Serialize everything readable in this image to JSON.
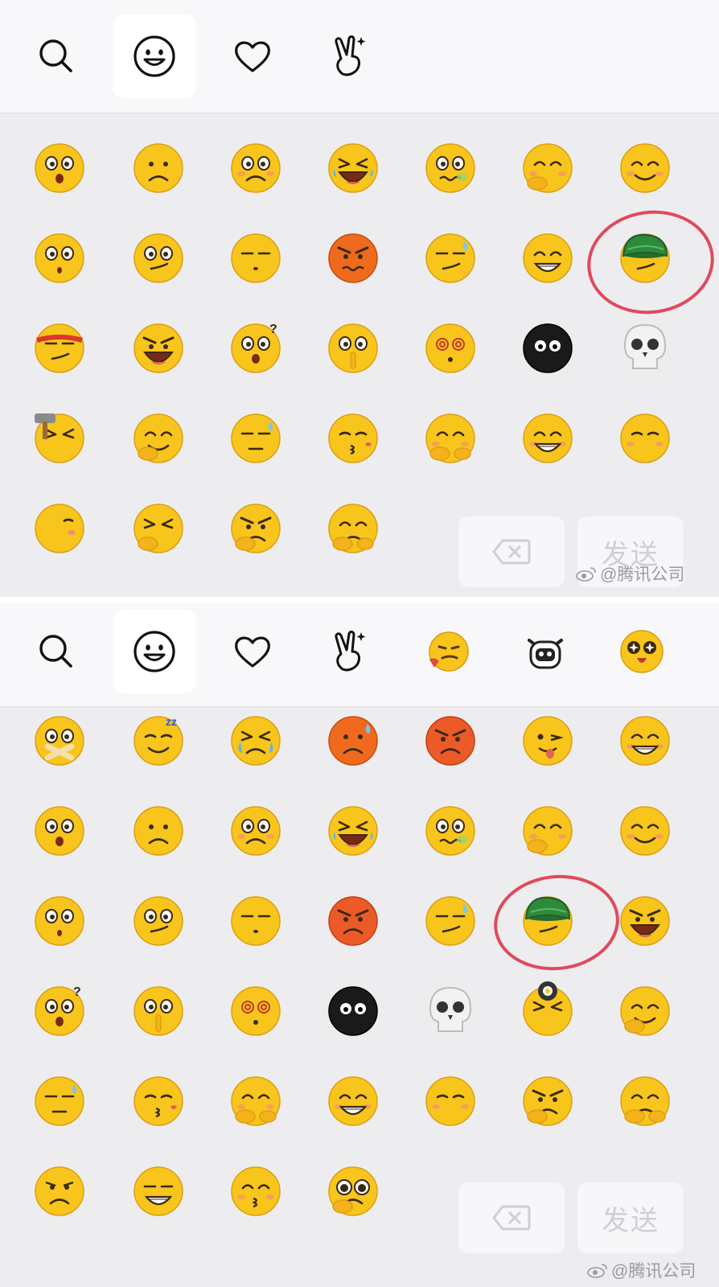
{
  "panels": [
    {
      "name": "old-panel",
      "tabs": [
        "search-icon",
        "smiley-icon",
        "heart-icon",
        "peace-hand-icon"
      ],
      "emojis": [
        "shocked",
        "frown",
        "teary",
        "laugh-cry",
        "nauseous",
        "cover-mouth",
        "smile",
        "stunned",
        "skeptical",
        "sleepy",
        "angry",
        "awkward-sweat",
        "grin",
        "green-cap",
        "headband",
        "crazy-laugh",
        "question",
        "shush",
        "dizzy",
        "black-blob",
        "skull",
        "hammer",
        "hand-chin",
        "sweat-smirk",
        "blow-kiss",
        "shy-cover",
        "big-grin",
        "nod",
        "turn-away",
        "giggle",
        "hmph",
        "peek"
      ],
      "delete_label": "⌫",
      "send_label": "发送",
      "watermark": "@腾讯公司"
    },
    {
      "name": "new-panel",
      "tabs": [
        "search-icon",
        "smiley-icon",
        "heart-icon",
        "peace-hand-icon",
        "smirk-sticker-icon",
        "cow-sticker-icon",
        "star-eyes-sticker-icon"
      ],
      "emojis": [
        "mouth-taped",
        "sleeping",
        "crying",
        "sweat-red",
        "angry-red",
        "tongue-wink",
        "big-grin",
        "shocked",
        "frown",
        "teary",
        "laugh-cry",
        "nauseous",
        "cover-mouth",
        "smile",
        "stunned",
        "skeptical",
        "sleepy",
        "angry-red",
        "awkward-sweat",
        "green-cap",
        "crazy-laugh",
        "question",
        "shush",
        "dizzy",
        "black-blob",
        "skull",
        "frying-pan",
        "hand-chin",
        "sweat-smirk",
        "blow-kiss",
        "shy-cover",
        "big-grin",
        "nod",
        "hmph",
        "peek",
        "sad",
        "smug",
        "kiss",
        "puppy"
      ],
      "delete_label": "⌫",
      "send_label": "发送",
      "watermark": "@腾讯公司"
    }
  ],
  "colors": {
    "emoji_yellow": "#f8c51c",
    "highlight_circle": "#e04a5c",
    "cap_green": "#2d8a3a"
  }
}
